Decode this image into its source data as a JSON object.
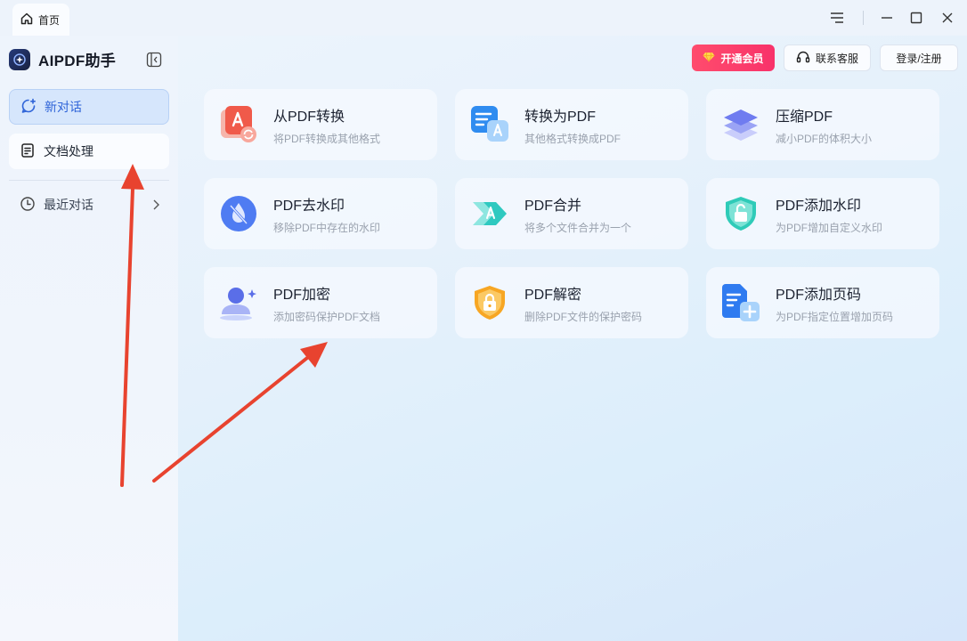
{
  "titlebar": {
    "tab_label": "首页"
  },
  "sidebar": {
    "brand": "AIPDF助手",
    "items": [
      {
        "label": "新对话"
      },
      {
        "label": "文档处理"
      }
    ],
    "recent_label": "最近对话"
  },
  "header": {
    "vip_label": "开通会员",
    "service_label": "联系客服",
    "login_label": "登录/注册"
  },
  "tools": [
    {
      "title": "从PDF转换",
      "desc": "将PDF转换成其他格式",
      "icon": "pdf-convert-from-icon"
    },
    {
      "title": "转换为PDF",
      "desc": "其他格式转换成PDF",
      "icon": "convert-to-pdf-icon"
    },
    {
      "title": "压缩PDF",
      "desc": "减小PDF的体积大小",
      "icon": "compress-layers-icon"
    },
    {
      "title": "PDF去水印",
      "desc": "移除PDF中存在的水印",
      "icon": "remove-watermark-icon"
    },
    {
      "title": "PDF合并",
      "desc": "将多个文件合并为一个",
      "icon": "merge-pdf-icon"
    },
    {
      "title": "PDF添加水印",
      "desc": "为PDF增加自定义水印",
      "icon": "add-watermark-shield-icon"
    },
    {
      "title": "PDF加密",
      "desc": "添加密码保护PDF文档",
      "icon": "encrypt-user-icon"
    },
    {
      "title": "PDF解密",
      "desc": "删除PDF文件的保护密码",
      "icon": "decrypt-lock-icon"
    },
    {
      "title": "PDF添加页码",
      "desc": "为PDF指定位置增加页码",
      "icon": "add-page-number-icon"
    }
  ],
  "colors": {
    "accent": "#2f64d8",
    "vip": "#f8326a",
    "annotation_arrow": "#e8432f"
  }
}
